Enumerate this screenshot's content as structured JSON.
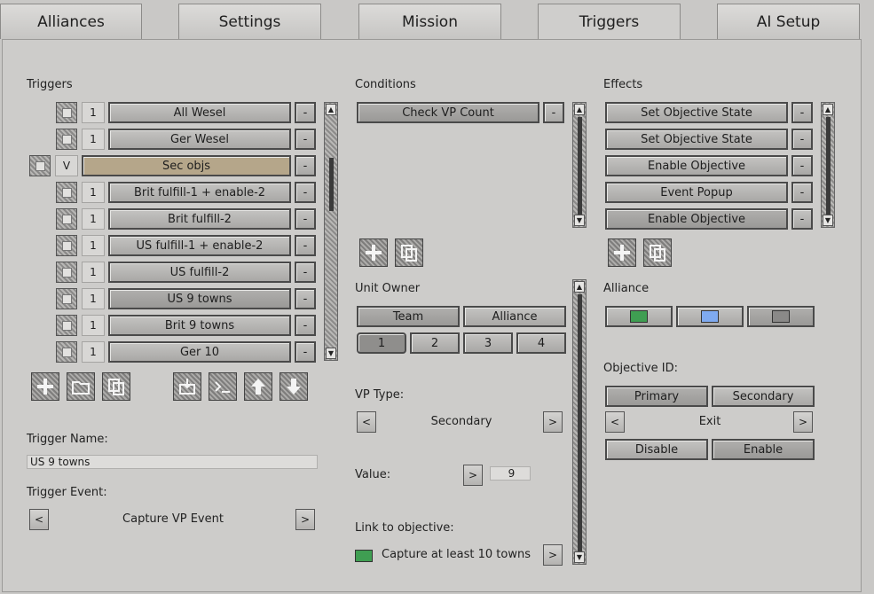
{
  "tabs": [
    {
      "label": "Alliances"
    },
    {
      "label": "Settings"
    },
    {
      "label": "Mission"
    },
    {
      "label": "Triggers"
    },
    {
      "label": "AI Setup"
    }
  ],
  "triggers": {
    "heading": "Triggers",
    "rows": [
      {
        "num": "1",
        "label": "All Wesel"
      },
      {
        "num": "1",
        "label": "Ger Wesel"
      },
      {
        "num": "V",
        "label": "Sec objs"
      },
      {
        "num": "1",
        "label": "Brit fulfill-1 + enable-2"
      },
      {
        "num": "1",
        "label": "Brit fulfill-2"
      },
      {
        "num": "1",
        "label": "US fulfill-1 + enable-2"
      },
      {
        "num": "1",
        "label": "US fulfill-2"
      },
      {
        "num": "1",
        "label": "US 9 towns"
      },
      {
        "num": "1",
        "label": "Brit 9 towns"
      },
      {
        "num": "1",
        "label": "Ger 10"
      }
    ],
    "minus": "-",
    "name_label": "Trigger Name:",
    "name_value": "US 9 towns",
    "event_label": "Trigger Event:",
    "event_value": "Capture VP Event",
    "prev": "<",
    "next": ">"
  },
  "conditions": {
    "heading": "Conditions",
    "items": [
      {
        "label": "Check VP Count"
      }
    ],
    "minus": "-",
    "unit_owner_label": "Unit Owner",
    "team_label": "Team",
    "alliance_label": "Alliance",
    "owners": [
      "1",
      "2",
      "3",
      "4"
    ],
    "vp_type_label": "VP Type:",
    "vp_type_value": "Secondary",
    "value_label": "Value:",
    "value": "9",
    "link_label": "Link to objective:",
    "link_value": "Capture at least 10 towns",
    "link_color": "#3f9e52",
    "prev": "<",
    "next": ">"
  },
  "effects": {
    "heading": "Effects",
    "items": [
      {
        "label": "Set Objective State"
      },
      {
        "label": "Set Objective State"
      },
      {
        "label": "Enable Objective"
      },
      {
        "label": "Event Popup"
      },
      {
        "label": "Enable Objective"
      }
    ],
    "minus": "-",
    "alliance_label": "Alliance",
    "alliance_colors": [
      "#3f9e52",
      "#7faaf0",
      "#8a8988"
    ],
    "objective_id_label": "Objective ID:",
    "primary_label": "Primary",
    "secondary_label": "Secondary",
    "objective_value": "Exit",
    "disable_label": "Disable",
    "enable_label": "Enable",
    "prev": "<",
    "next": ">"
  }
}
